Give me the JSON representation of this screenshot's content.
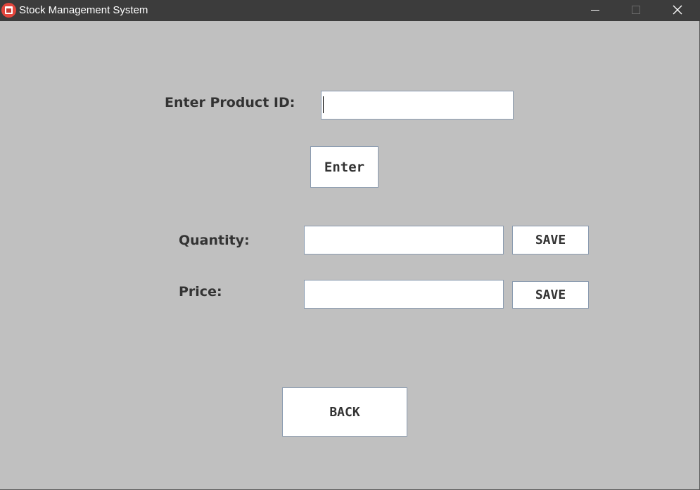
{
  "window": {
    "title": "Stock Management System",
    "icon": "app-icon",
    "controls": {
      "minimize_icon": "minimize-icon",
      "maximize_icon": "maximize-icon",
      "close_icon": "close-icon"
    }
  },
  "form": {
    "product_id_label": "Enter Product ID:",
    "product_id_value": "",
    "enter_button": "Enter",
    "quantity_label": "Quantity:",
    "quantity_value": "",
    "quantity_save_button": "SAVE",
    "price_label": "Price:",
    "price_value": "",
    "price_save_button": "SAVE",
    "back_button": "BACK"
  },
  "colors": {
    "background": "#c0c0c0",
    "titlebar": "#3c3c3c",
    "label_text": "#333333",
    "field_border": "#8a9bb0",
    "app_icon": "#e3463d"
  }
}
